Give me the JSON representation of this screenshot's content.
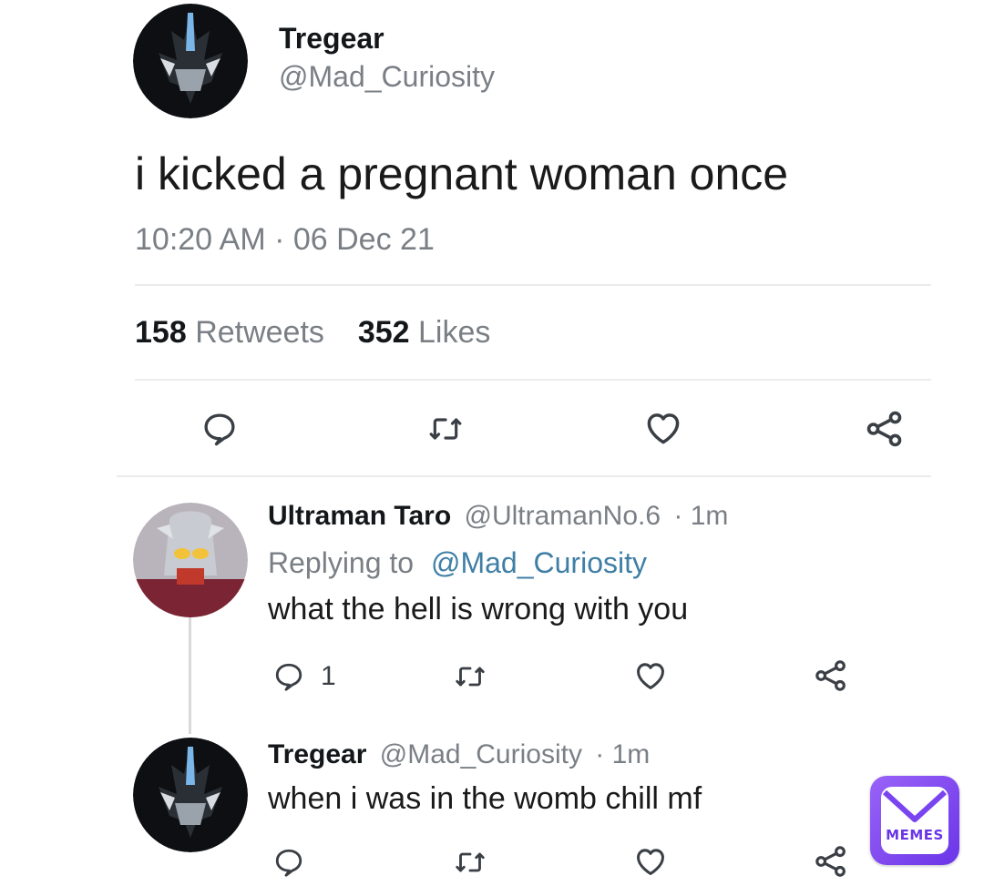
{
  "main_tweet": {
    "display_name": "Tregear",
    "handle": "@Mad_Curiosity",
    "text": "i kicked a pregnant woman once",
    "timestamp": "10:20 AM · 06 Dec 21",
    "retweets_count": "158",
    "retweets_label": "Retweets",
    "likes_count": "352",
    "likes_label": "Likes"
  },
  "replies": [
    {
      "display_name": "Ultraman Taro",
      "handle": "@UltramanNo.6",
      "time": "· 1m",
      "replying_label": "Replying to",
      "replying_handle": "@Mad_Curiosity",
      "text": "what the hell is wrong with you",
      "reply_count": "1"
    },
    {
      "display_name": "Tregear",
      "handle": "@Mad_Curiosity",
      "time": "· 1m",
      "text": "when i was in the womb chill mf"
    }
  ],
  "watermark": {
    "text": "MEMES"
  },
  "icons": [
    "reply-icon",
    "retweet-icon",
    "like-icon",
    "share-icon",
    "mail-icon"
  ],
  "colors": {
    "link": "#3f7fa6",
    "muted": "#7a7f85",
    "watermark_start": "#8f5cf7",
    "watermark_end": "#6a35e8"
  }
}
